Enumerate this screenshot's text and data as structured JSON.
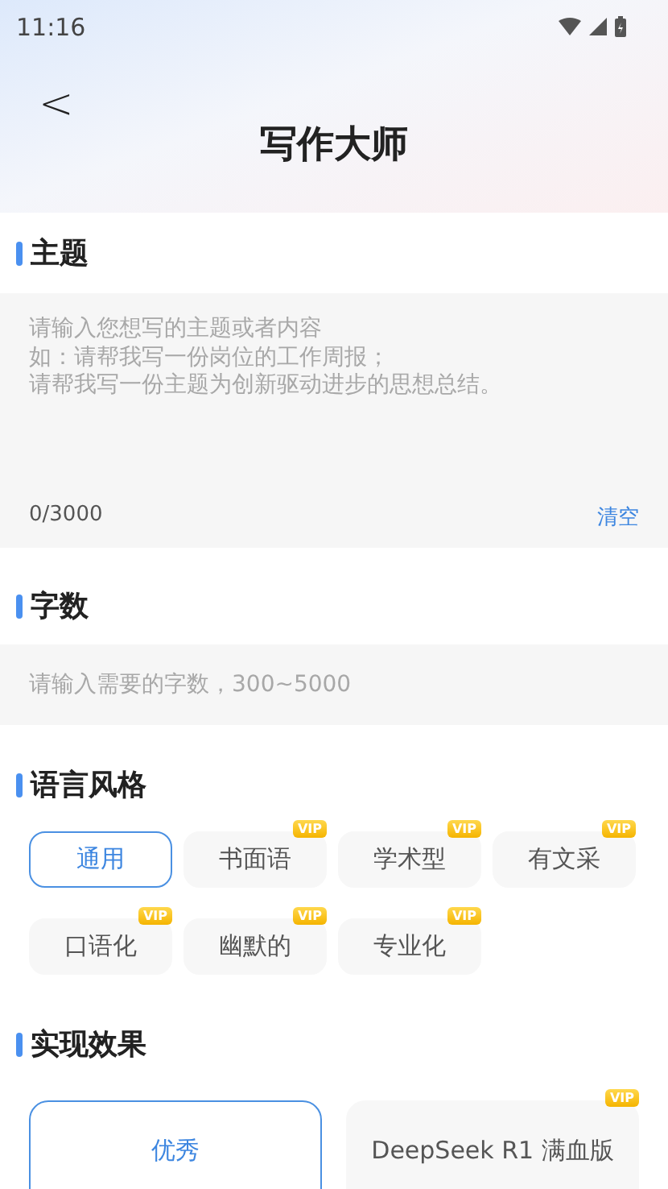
{
  "status_bar": {
    "time": "11:16"
  },
  "header": {
    "back": "<",
    "title": "写作大师"
  },
  "topic": {
    "title": "主题",
    "placeholder": [
      "请输入您想写的主题或者内容",
      "如：请帮我写一份岗位的工作周报；",
      "请帮我写一份主题为创新驱动进步的思想总结。"
    ],
    "counter": "0/3000",
    "clear": "清空"
  },
  "word_count": {
    "title": "字数",
    "placeholder": "请输入需要的字数，300~5000"
  },
  "style": {
    "title": "语言风格",
    "options": [
      {
        "label": "通用",
        "selected": true
      },
      {
        "label": "书面语",
        "selected": false,
        "badge": "VIP"
      },
      {
        "label": "学术型",
        "selected": false,
        "badge": "VIP"
      },
      {
        "label": "有文采",
        "selected": false,
        "badge": "VIP"
      },
      {
        "label": "口语化",
        "selected": false,
        "badge": "VIP"
      },
      {
        "label": "幽默的",
        "selected": false,
        "badge": "VIP"
      },
      {
        "label": "专业化",
        "selected": false,
        "badge": "VIP"
      }
    ]
  },
  "effect": {
    "title": "实现效果",
    "options": [
      {
        "label": "优秀",
        "selected": true
      },
      {
        "label": "DeepSeek R1 满血版",
        "selected": false,
        "badge": "VIP"
      }
    ]
  }
}
